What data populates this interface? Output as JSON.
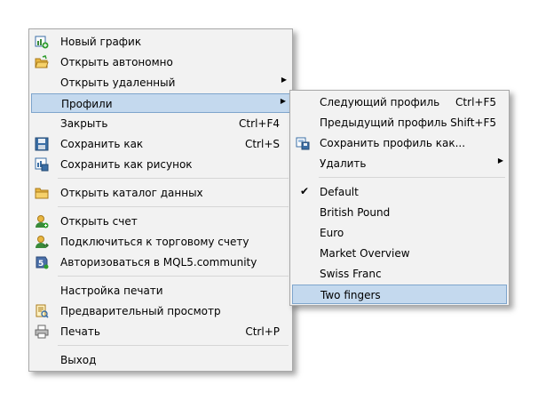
{
  "main_menu": {
    "items": [
      {
        "label": "Новый график",
        "shortcut": "",
        "icon": "new-chart-icon"
      },
      {
        "label": "Открыть автономно",
        "shortcut": "",
        "icon": "open-folder-icon"
      },
      {
        "label": "Открыть удаленный",
        "shortcut": "",
        "submenu": true
      },
      {
        "label": "Профили",
        "shortcut": "",
        "submenu": true,
        "highlighted": true
      },
      {
        "label": "Закрыть",
        "shortcut": "Ctrl+F4"
      },
      {
        "label": "Сохранить как",
        "shortcut": "Ctrl+S",
        "icon": "save-icon"
      },
      {
        "label": "Сохранить как рисунок",
        "shortcut": "",
        "icon": "save-picture-icon"
      },
      {
        "label": "Открыть каталог данных",
        "shortcut": "",
        "icon": "folder-icon"
      },
      {
        "label": "Открыть счет",
        "shortcut": "",
        "icon": "user-add-icon"
      },
      {
        "label": "Подключиться к торговому счету",
        "shortcut": "",
        "icon": "user-connect-icon"
      },
      {
        "label": "Авторизоваться в MQL5.community",
        "shortcut": "",
        "icon": "mql5-login-icon"
      },
      {
        "label": "Настройка печати",
        "shortcut": ""
      },
      {
        "label": "Предварительный просмотр",
        "shortcut": "",
        "icon": "print-preview-icon"
      },
      {
        "label": "Печать",
        "shortcut": "Ctrl+P",
        "icon": "printer-icon"
      },
      {
        "label": "Выход",
        "shortcut": ""
      }
    ]
  },
  "sub_menu": {
    "items": [
      {
        "label": "Следующий профиль",
        "shortcut": "Ctrl+F5"
      },
      {
        "label": "Предыдущий профиль",
        "shortcut": "Shift+F5"
      },
      {
        "label": "Сохранить профиль как...",
        "shortcut": "",
        "icon": "save-profile-icon"
      },
      {
        "label": "Удалить",
        "shortcut": "",
        "submenu": true
      },
      {
        "label": "Default",
        "checked": true
      },
      {
        "label": "British Pound"
      },
      {
        "label": "Euro"
      },
      {
        "label": "Market Overview"
      },
      {
        "label": "Swiss Franc"
      },
      {
        "label": "Two fingers",
        "highlighted": true
      }
    ]
  },
  "colors": {
    "menu_bg": "#f2f2f2",
    "highlight_bg": "#c4d9ee",
    "highlight_border": "#7ea5cc"
  }
}
